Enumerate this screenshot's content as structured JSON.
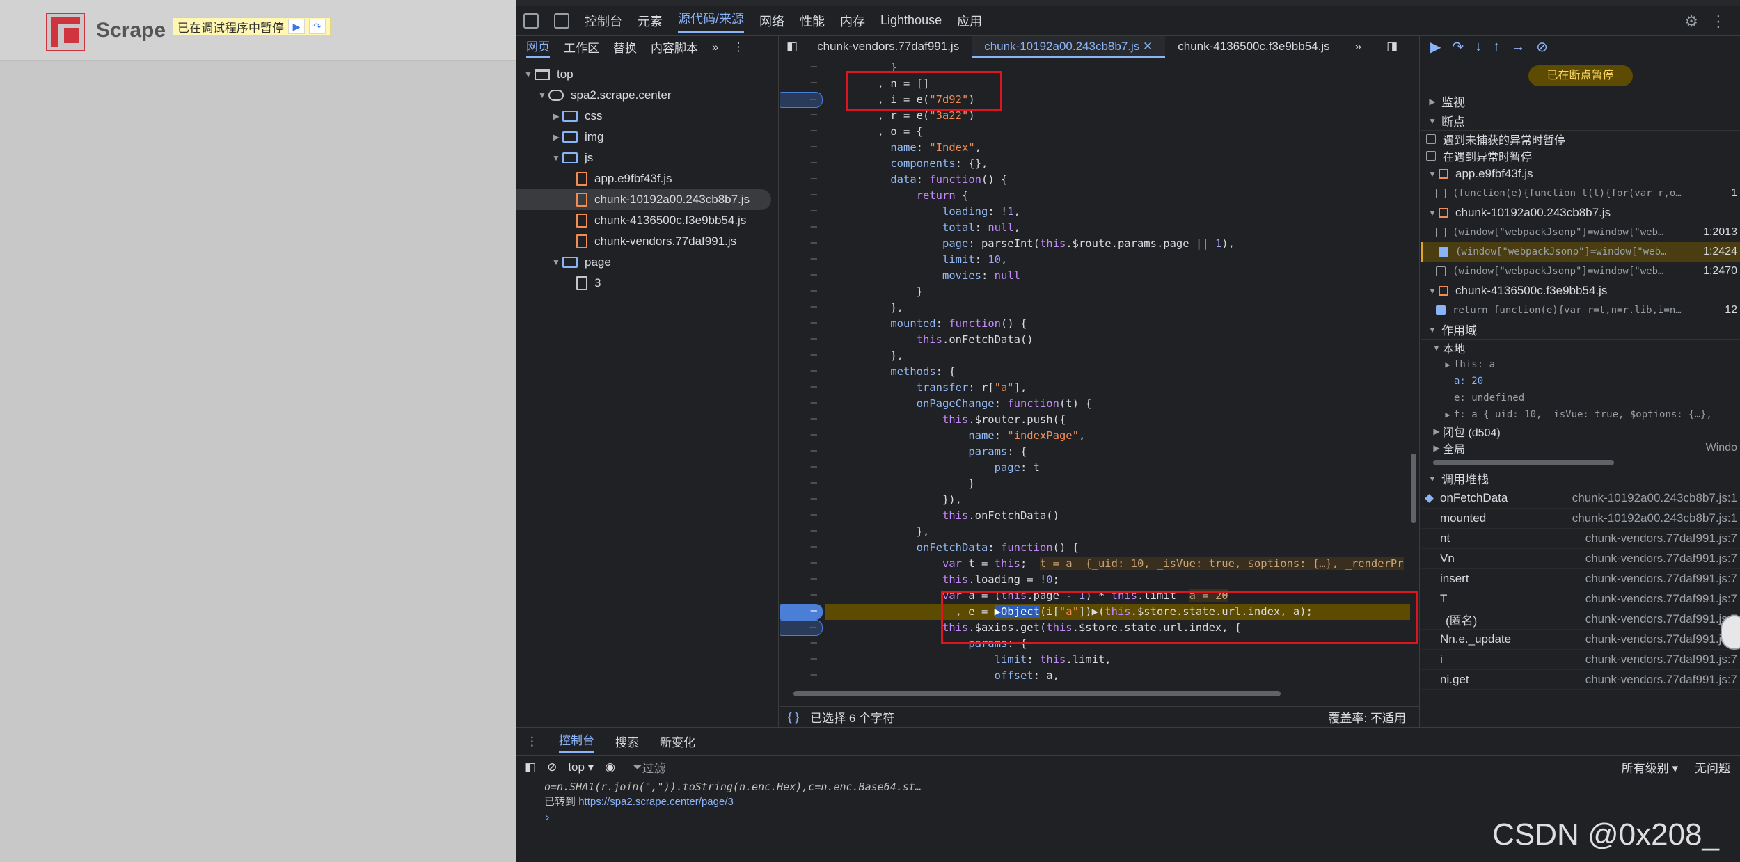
{
  "page": {
    "brand": "Scrape",
    "paused_text": "已在调试程序中暂停"
  },
  "toolbar": {
    "tabs": [
      "控制台",
      "元素",
      "源代码/来源",
      "网络",
      "性能",
      "内存",
      "Lighthouse",
      "应用"
    ],
    "active": "源代码/来源"
  },
  "navigator": {
    "tabs": [
      "网页",
      "工作区",
      "替换",
      "内容脚本"
    ],
    "tree": {
      "top": "top",
      "domain": "spa2.scrape.center",
      "css": "css",
      "img": "img",
      "js": "js",
      "files": [
        "app.e9fbf43f.js",
        "chunk-10192a00.243cb8b7.js",
        "chunk-4136500c.f3e9bb54.js",
        "chunk-vendors.77daf991.js"
      ],
      "page": "page",
      "page_item": "3"
    }
  },
  "editor": {
    "tabs": [
      "chunk-vendors.77daf991.js",
      "chunk-10192a00.243cb8b7.js",
      "chunk-4136500c.f3e9bb54.js"
    ],
    "status_left": "已选择 6 个字符",
    "status_right": "覆盖率: 不适用"
  },
  "debugger": {
    "paused_badge": "已在断点暂停",
    "sections": {
      "watch": "监视",
      "breakpoints": "断点",
      "pause_uncaught": "遇到未捕获的异常时暂停",
      "pause_caught": "在遇到异常时暂停",
      "scope": "作用域",
      "local": "本地",
      "closure": "闭包 (d504)",
      "global": "全局",
      "global_val": "Windo",
      "callstack": "调用堆栈"
    },
    "bp_files": [
      {
        "name": "app.e9fbf43f.js",
        "lines": [
          {
            "code": "(function(e){function t(t){for(var r,o…",
            "loc": "1",
            "checked": false
          }
        ]
      },
      {
        "name": "chunk-10192a00.243cb8b7.js",
        "lines": [
          {
            "code": "(window[\"webpackJsonp\"]=window[\"web…",
            "loc": "1:2013",
            "checked": false
          },
          {
            "code": "(window[\"webpackJsonp\"]=window[\"web…",
            "loc": "1:2424",
            "checked": true
          },
          {
            "code": "(window[\"webpackJsonp\"]=window[\"web…",
            "loc": "1:2470",
            "checked": false
          }
        ]
      },
      {
        "name": "chunk-4136500c.f3e9bb54.js",
        "lines": [
          {
            "code": "return function(e){var r=t,n=r.lib,i=n…",
            "loc": "12",
            "checked": true
          }
        ]
      }
    ],
    "scope_items": {
      "this": "this: a",
      "a": "a: 20",
      "e": "e: undefined",
      "t": "t: a  {_uid: 10, _isVue: true, $options: {…},"
    },
    "callstack": [
      {
        "fn": "onFetchData",
        "loc": "chunk-10192a00.243cb8b7.js:1"
      },
      {
        "fn": "mounted",
        "loc": "chunk-10192a00.243cb8b7.js:1"
      },
      {
        "fn": "nt",
        "loc": "chunk-vendors.77daf991.js:7"
      },
      {
        "fn": "Vn",
        "loc": "chunk-vendors.77daf991.js:7"
      },
      {
        "fn": "insert",
        "loc": "chunk-vendors.77daf991.js:7"
      },
      {
        "fn": "T",
        "loc": "chunk-vendors.77daf991.js:7"
      },
      {
        "fn": "(匿名)",
        "loc": "chunk-vendors.77daf991.js:7"
      },
      {
        "fn": "Nn.e._update",
        "loc": "chunk-vendors.77daf991.js:7"
      },
      {
        "fn": "i",
        "loc": "chunk-vendors.77daf991.js:7"
      },
      {
        "fn": "ni.get",
        "loc": "chunk-vendors.77daf991.js:7"
      }
    ]
  },
  "drawer": {
    "tabs": [
      "控制台",
      "搜索",
      "新变化"
    ],
    "context": "top",
    "filter": "过滤",
    "levels": "所有级别",
    "issues": "无问题",
    "console_line1": "o=n.SHA1(r.join(\",\")).toString(n.enc.Hex),c=n.enc.Base64.st…",
    "nav_prefix": "已转到",
    "nav_url": "https://spa2.scrape.center/page/3"
  },
  "watermark": "CSDN @0x208_"
}
